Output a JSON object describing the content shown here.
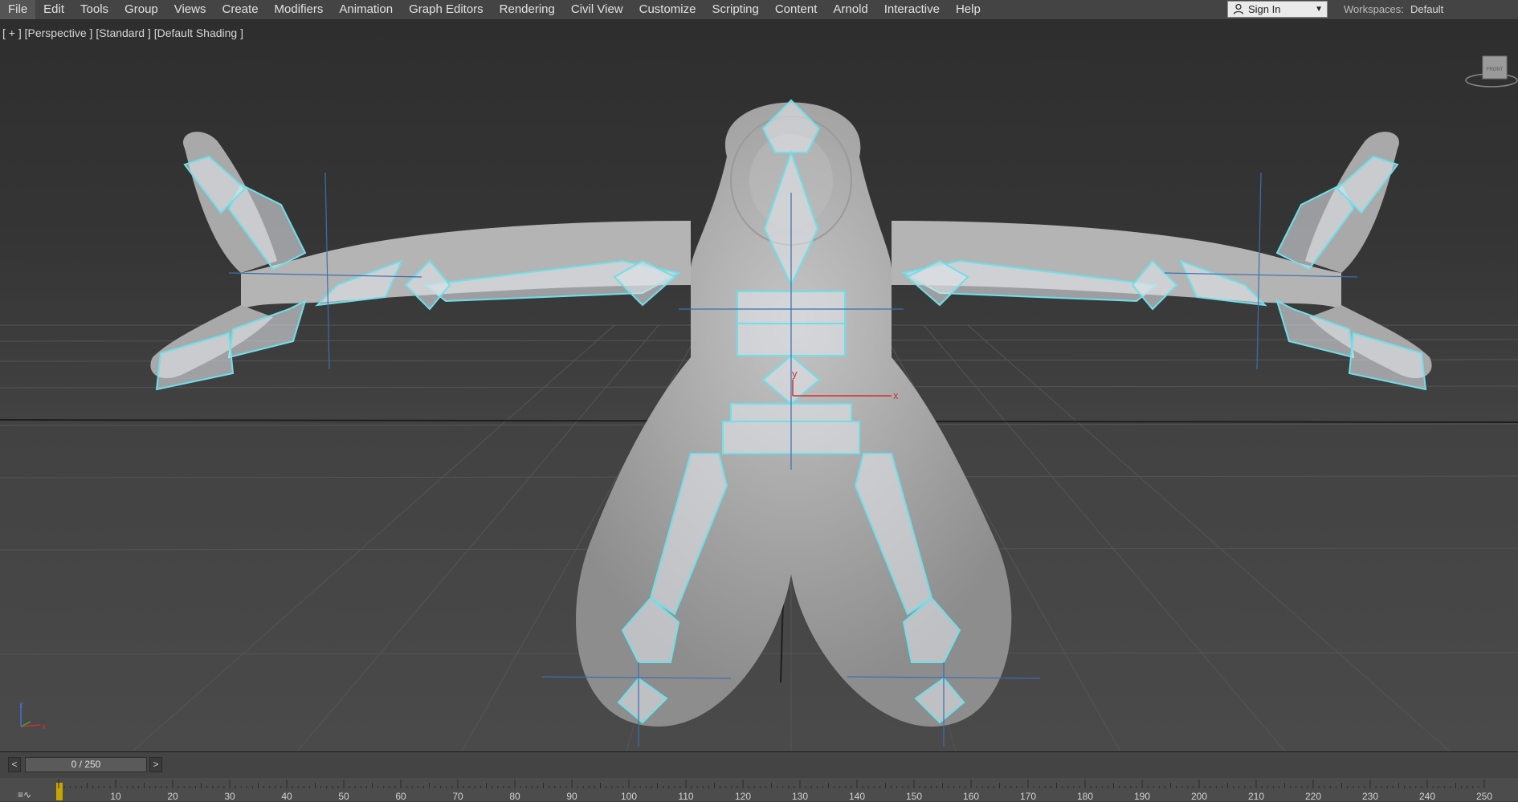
{
  "menu": [
    "File",
    "Edit",
    "Tools",
    "Group",
    "Views",
    "Create",
    "Modifiers",
    "Animation",
    "Graph Editors",
    "Rendering",
    "Civil View",
    "Customize",
    "Scripting",
    "Content",
    "Arnold",
    "Interactive",
    "Help"
  ],
  "signin": {
    "label": "Sign In",
    "icon": "user-icon"
  },
  "workspaces": {
    "label": "Workspaces:",
    "value": "Default"
  },
  "viewport": {
    "label": "[ + ] [Perspective ] [Standard ] [Default Shading ]"
  },
  "view_cube": {
    "label": "FRONT"
  },
  "gizmo": {
    "x": "x",
    "y": "y",
    "z": "z"
  },
  "timeline": {
    "frame": "0 / 250",
    "prev": "<",
    "next": ">",
    "ticks": [
      "10",
      "20",
      "30",
      "40",
      "50",
      "60",
      "70",
      "80",
      "90",
      "100",
      "110",
      "120",
      "130",
      "140",
      "150",
      "160",
      "170",
      "180",
      "190",
      "200",
      "210",
      "220",
      "230",
      "240",
      "250"
    ]
  },
  "colors": {
    "bone_outline": "#6de0ea",
    "body": "#b0b0b0",
    "accent": "#c8a400"
  }
}
